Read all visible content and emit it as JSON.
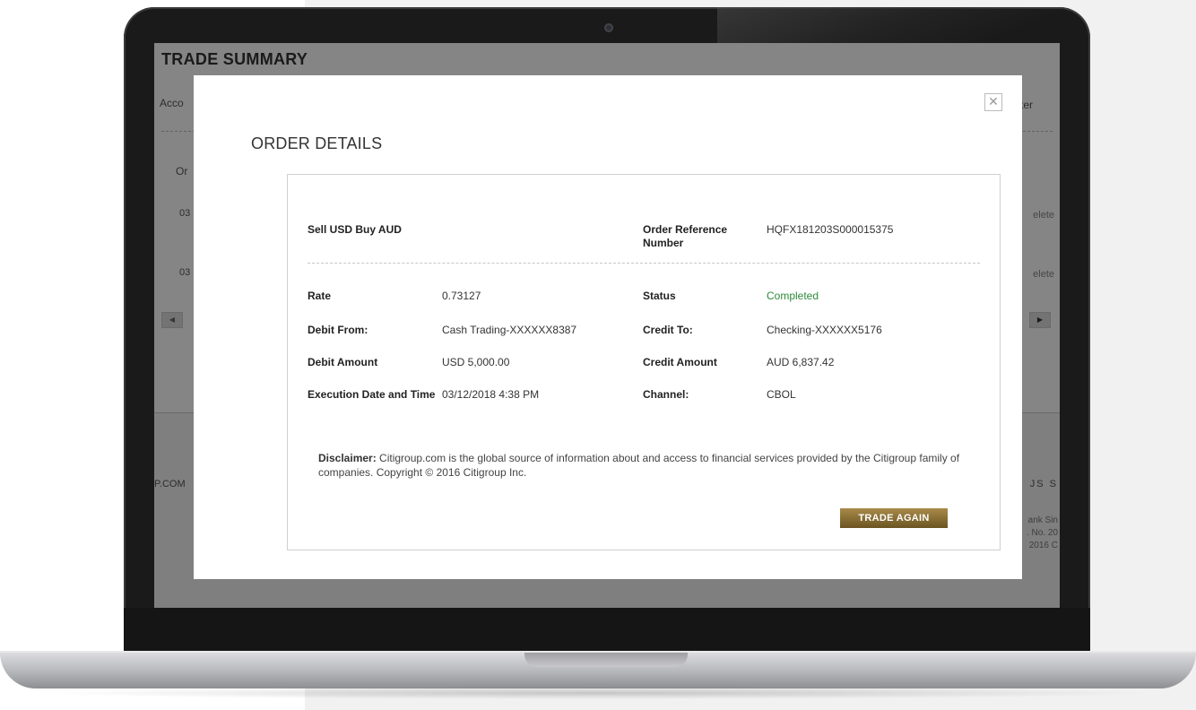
{
  "page": {
    "title": "TRADE SUMMARY",
    "account_label": "Acco",
    "filter_label": "ter",
    "order_col": "Or",
    "row1_date": "03",
    "row2_date": "03",
    "delete_label": "elete",
    "scroll_left": "◀",
    "scroll_right": "▶",
    "footer_left": "P.COM",
    "footer_right": "JS  S",
    "copyright_lines": "ank Sin\n. No. 20\n2016 C"
  },
  "modal": {
    "title": "ORDER DETAILS",
    "close_icon": "close-icon",
    "trade_type": "Sell USD Buy AUD",
    "order_ref_label": "Order Reference Number",
    "order_ref_value": "HQFX181203S000015375",
    "rate_label": "Rate",
    "rate_value": "0.73127",
    "status_label": "Status",
    "status_value": "Completed",
    "debit_from_label": "Debit From:",
    "debit_from_value": "Cash Trading-XXXXXX8387",
    "credit_to_label": "Credit To:",
    "credit_to_value": "Checking-XXXXXX5176",
    "debit_amount_label": "Debit Amount",
    "debit_amount_value": "USD 5,000.00",
    "credit_amount_label": "Credit Amount",
    "credit_amount_value": "AUD 6,837.42",
    "exec_label": "Execution Date and Time",
    "exec_value": "03/12/2018 4:38 PM",
    "channel_label": "Channel:",
    "channel_value": "CBOL",
    "disclaimer_label": "Disclaimer:",
    "disclaimer_text": " Citigroup.com is the global source of information about and access to financial services provided by the Citigroup family of companies. Copyright © 2016 Citigroup Inc.",
    "trade_again_label": "TRADE AGAIN"
  },
  "colors": {
    "status_green": "#2e8b3a",
    "button_gold": "#8a6d34"
  }
}
